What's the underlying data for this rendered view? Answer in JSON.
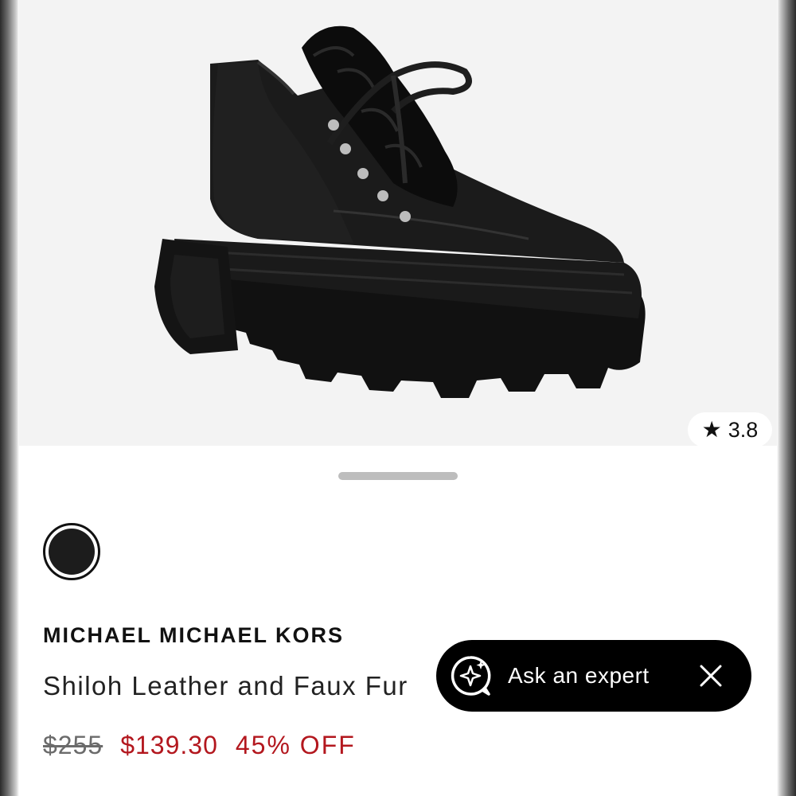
{
  "product": {
    "image_alt": "Black leather platform lug sole shoe with faux fur lace panel",
    "rating": "3.8",
    "rating_icon": "star-icon",
    "color_swatch": {
      "color": "#1c1c1c",
      "selected": true
    },
    "brand": "MICHAEL MICHAEL KORS",
    "name": "Shiloh Leather and Faux Fur",
    "price": {
      "original": "$255",
      "sale": "$139.30",
      "discount": "45% OFF"
    }
  },
  "expert_chip": {
    "label": "Ask an expert",
    "icon": "sparkle-chat-icon",
    "close_icon": "close-icon"
  },
  "colors": {
    "sale_red": "#b3171e",
    "hero_bg": "#f3f3f3",
    "chip_bg": "#000000"
  }
}
